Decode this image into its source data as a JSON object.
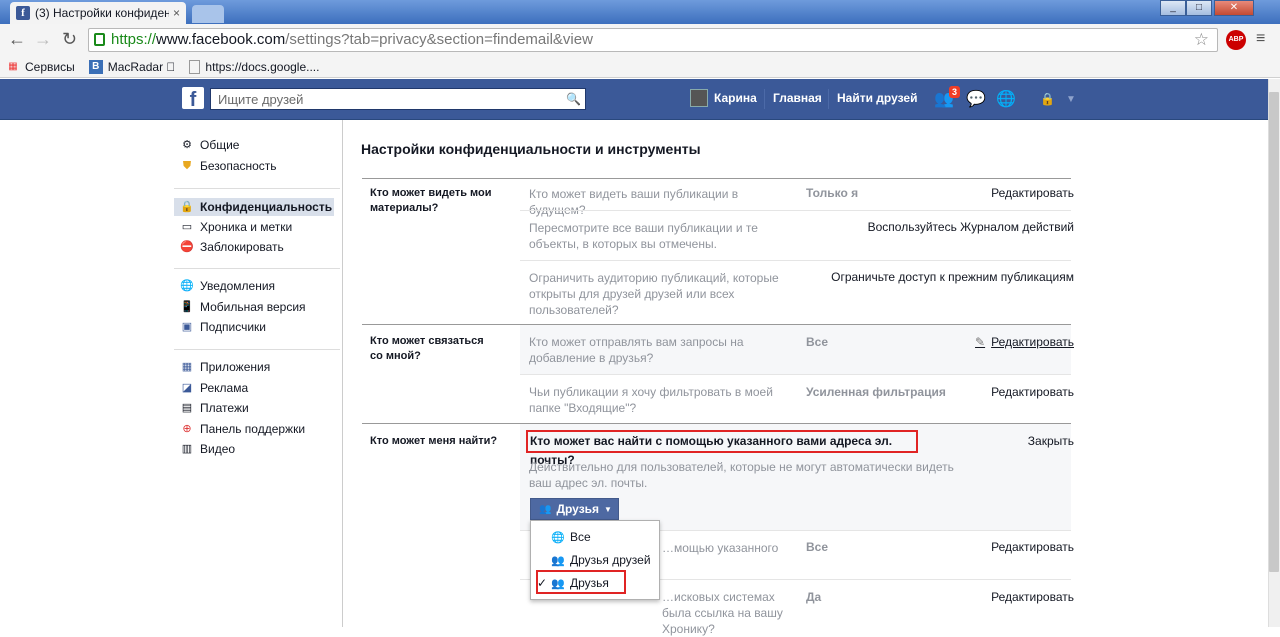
{
  "browser": {
    "tab_title": "(3) Настройки конфиденц",
    "tab_close": "×",
    "url_https": "https://",
    "url_host": "www.facebook.com",
    "url_rest": "/settings?tab=privacy&section=findemail&view",
    "abp_label": "ABP",
    "bookmarks": [
      "Сервисы",
      "MacRadar ",
      "https://docs.google...."
    ],
    "win_min": "_",
    "win_max": "□",
    "win_close": "✕"
  },
  "fb_header": {
    "logo": "f",
    "search_placeholder": "Ищите друзей",
    "user_name": "Карина",
    "home": "Главная",
    "find_friends": "Найти друзей",
    "friend_requests_count": "3"
  },
  "sidebar": {
    "groups": [
      [
        {
          "label": "Общие",
          "icon": "gear-icon"
        },
        {
          "label": "Безопасность",
          "icon": "shield-icon"
        }
      ],
      [
        {
          "label": "Конфиденциальность",
          "icon": "lock-icon",
          "selected": true
        },
        {
          "label": "Хроника и метки",
          "icon": "timeline-icon"
        },
        {
          "label": "Заблокировать",
          "icon": "block-icon"
        }
      ],
      [
        {
          "label": "Уведомления",
          "icon": "globe-icon"
        },
        {
          "label": "Мобильная версия",
          "icon": "mobile-icon"
        },
        {
          "label": "Подписчики",
          "icon": "rss-icon"
        }
      ],
      [
        {
          "label": "Приложения",
          "icon": "apps-icon"
        },
        {
          "label": "Реклама",
          "icon": "ads-icon"
        },
        {
          "label": "Платежи",
          "icon": "payments-icon"
        },
        {
          "label": "Панель поддержки",
          "icon": "support-icon"
        },
        {
          "label": "Видео",
          "icon": "video-icon"
        }
      ]
    ]
  },
  "main": {
    "title": "Настройки конфиденциальности и инструменты",
    "sections": {
      "s1_label": "Кто может видеть мои материалы?",
      "s1_rows": [
        {
          "q": "Кто может видеть ваши публикации в будущем?",
          "v": "Только я",
          "edit": "Редактировать"
        },
        {
          "q": "Пересмотрите все ваши публикации и те объекты, в которых вы отмечены.",
          "v": "",
          "edit": "Воспользуйтесь Журналом действий"
        },
        {
          "q": "Ограничить аудиторию публикаций, которые открыты для друзей друзей или всех пользователей?",
          "v": "",
          "edit": "Ограничьте доступ к прежним публикациям"
        }
      ],
      "s2_label": "Кто может связаться со мной?",
      "s2_rows": [
        {
          "q": "Кто может отправлять вам запросы на добавление в друзья?",
          "v": "Все",
          "edit": "Редактировать"
        },
        {
          "q": "Чьи публикации я хочу фильтровать в моей папке \"Входящие\"?",
          "v": "Усиленная фильтрация",
          "edit": "Редактировать"
        }
      ],
      "s3_label": "Кто может меня найти?",
      "s3_active_q": "Кто может вас найти с помощью указанного вами адреса эл. почты?",
      "s3_close": "Закрыть",
      "s3_desc": "Действительно для пользователей, которые не могут автоматически видеть ваш адрес эл. почты.",
      "s3_button": "Друзья",
      "s3_rows": [
        {
          "q": "…мощью указанного",
          "v": "Все",
          "edit": "Редактировать"
        },
        {
          "q": "…исковых системах была ссылка на вашу Хронику?",
          "v": "Да",
          "edit": "Редактировать"
        }
      ]
    },
    "dropdown": {
      "options": [
        "Все",
        "Друзья друзей",
        "Друзья"
      ],
      "selected": "Друзья",
      "check": "✓"
    }
  }
}
